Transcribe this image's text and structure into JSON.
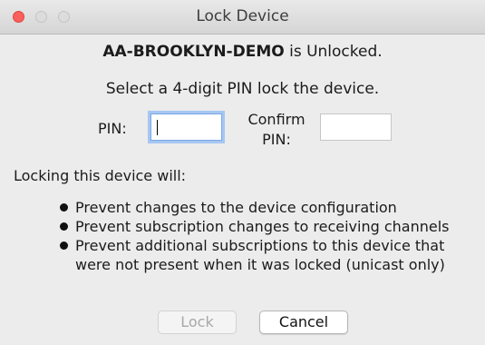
{
  "window": {
    "title": "Lock Device"
  },
  "status": {
    "device_name": "AA-BROOKLYN-DEMO",
    "status_suffix": " is Unlocked."
  },
  "instruction": "Select a 4-digit PIN lock the device.",
  "form": {
    "pin_label": "PIN:",
    "pin_value": "",
    "confirm_label_line1": "Confirm",
    "confirm_label_line2": "PIN:",
    "confirm_value": ""
  },
  "warning": {
    "heading": "Locking this device will:",
    "items": [
      {
        "line1": "Prevent changes to the device configuration",
        "line2": ""
      },
      {
        "line1": "Prevent subscription changes to receiving channels",
        "line2": ""
      },
      {
        "line1": "Prevent additional subscriptions to this device that",
        "line2": "were not present when it was locked (unicast only)"
      }
    ]
  },
  "buttons": {
    "lock_label": "Lock",
    "cancel_label": "Cancel"
  },
  "colors": {
    "close_button": "#fc605c",
    "focus_ring": "#a6c6f1",
    "background": "#ececec"
  }
}
